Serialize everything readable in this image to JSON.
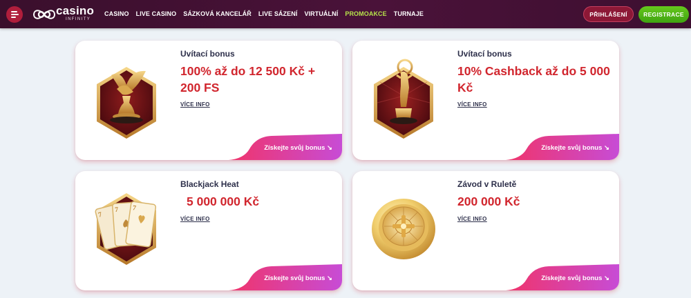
{
  "header": {
    "logo": {
      "word": "casino",
      "sub": "INFINITY"
    },
    "nav": [
      "CASINO",
      "LIVE CASINO",
      "SÁZKOVÁ KANCELÁŘ",
      "LIVE SÁZENÍ",
      "VIRTUÁLNÍ",
      "PROMOAKCE",
      "TURNAJE"
    ],
    "active_nav": "PROMOAKCE",
    "login_label": "PŘIHLÁŠENÍ",
    "register_label": "REGISTRACE",
    "colors": {
      "active_nav": "#b6e34a",
      "register": "#4fb517",
      "login": "#8c1836"
    }
  },
  "promotions": [
    {
      "label": "Uvítací bonus",
      "amount": "100% až do 12 500 Kč + 200 FS",
      "more": "VÍCE INFO",
      "cta": "Získejte svůj bonus ↘",
      "icon": "winged-lion-trophy-icon"
    },
    {
      "label": "Uvítací bonus",
      "amount": "10% Cashback až do 5 000 Kč",
      "more": "VÍCE INFO",
      "cta": "Získejte svůj bonus ↘",
      "icon": "golden-statue-trophy-icon"
    },
    {
      "label": "Blackjack Heat",
      "amount": "5 000 000 Kč",
      "more": "VÍCE INFO",
      "cta": "Získejte svůj bonus ↘",
      "icon": "playing-cards-icon"
    },
    {
      "label": "Závod v Ruletě",
      "amount": "200 000 Kč",
      "more": "VÍCE INFO",
      "cta": "Získejte svůj bonus ↘",
      "icon": "roulette-wheel-icon"
    }
  ],
  "colors": {
    "amount": "#d1262e",
    "cta_gradient": [
      "#f0346a",
      "#c74cd6"
    ]
  }
}
